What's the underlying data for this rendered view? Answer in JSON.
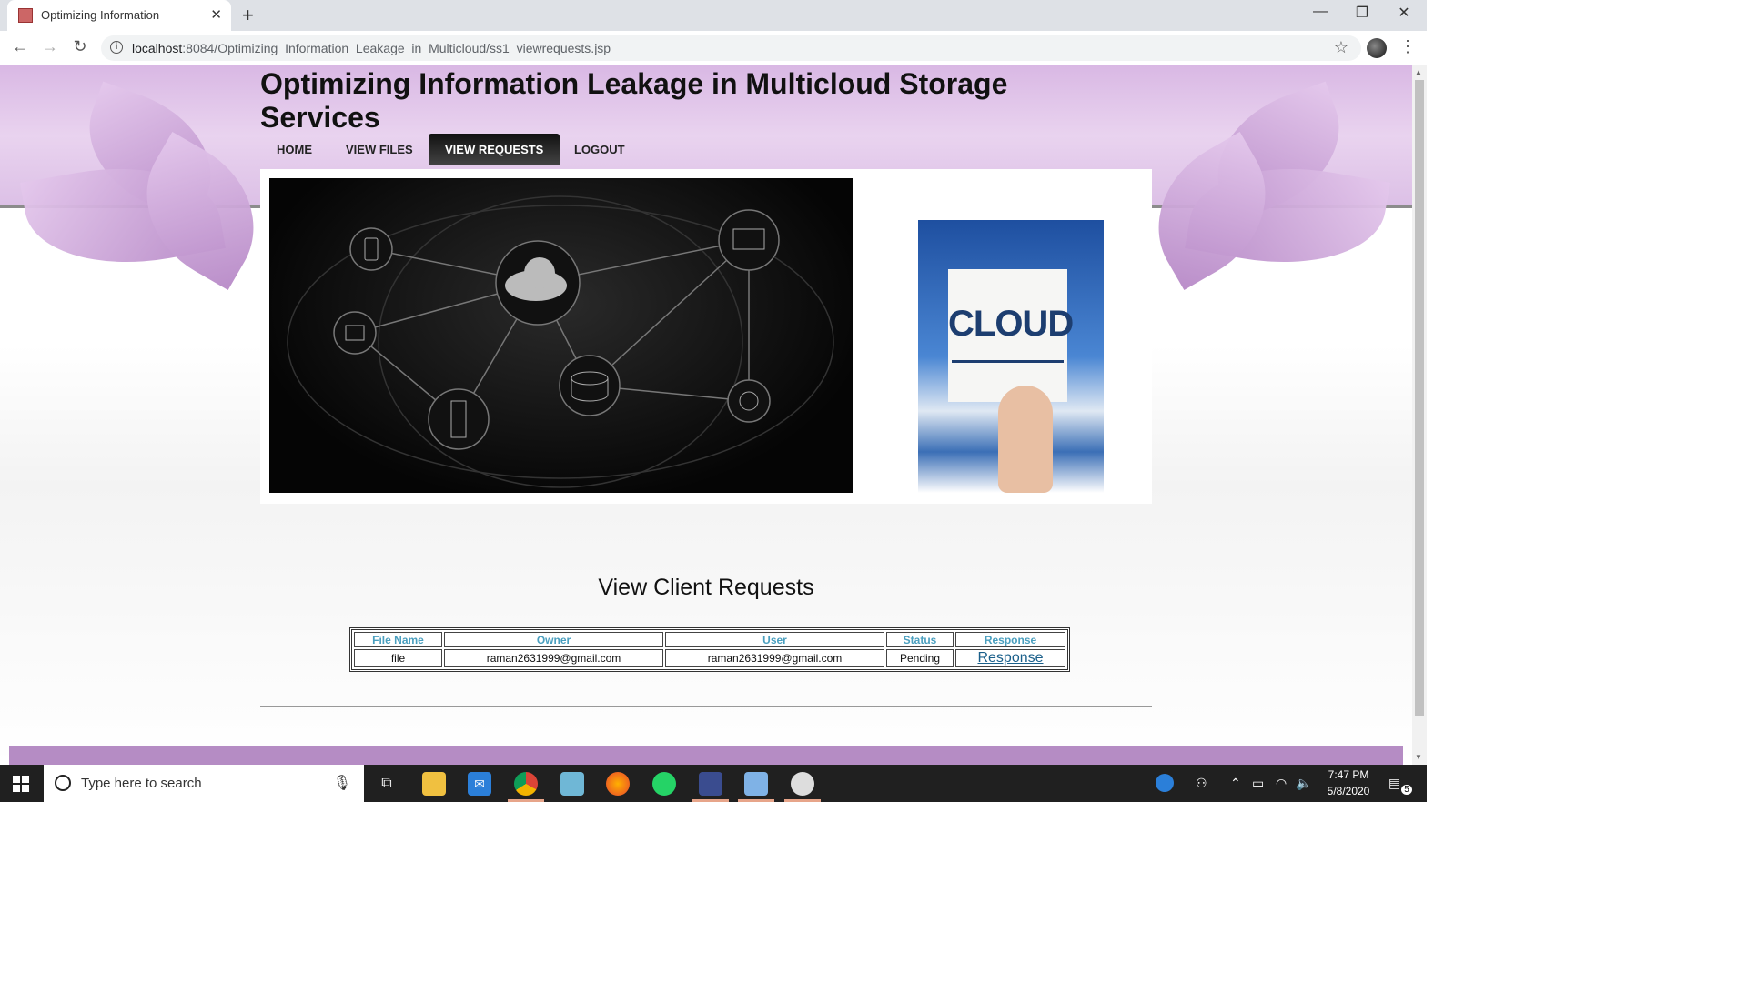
{
  "browser": {
    "tab_title": "Optimizing Information",
    "tab_close": "✕",
    "new_tab": "+",
    "url_host": "localhost",
    "url_rest": ":8084/Optimizing_Information_Leakage_in_Multicloud/ss1_viewrequests.jsp",
    "window_controls": [
      "—",
      "❐",
      "✕"
    ]
  },
  "site": {
    "title": "Optimizing Information Leakage in Multicloud Storage Services",
    "nav": [
      {
        "label": "HOME",
        "active": false
      },
      {
        "label": "VIEW FILES",
        "active": false
      },
      {
        "label": "VIEW REQUESTS",
        "active": true
      },
      {
        "label": "LOGOUT",
        "active": false
      }
    ],
    "cloud_image_word": "CLOUD"
  },
  "requests": {
    "heading": "View Client Requests",
    "columns": [
      "File Name",
      "Owner",
      "User",
      "Status",
      "Response"
    ],
    "rows": [
      {
        "file_name": "file",
        "owner": "raman2631999@gmail.com",
        "user": "raman2631999@gmail.com",
        "status": "Pending",
        "response": "Response"
      }
    ]
  },
  "taskbar": {
    "search_placeholder": "Type here to search",
    "time": "7:47 PM",
    "date": "5/8/2020",
    "notification_count": "5"
  },
  "colors": {
    "header_purple": "#d9b8e4",
    "footer_purple": "#b58cc4",
    "table_header_text": "#4a9fbf",
    "link": "#1a5f8a"
  }
}
